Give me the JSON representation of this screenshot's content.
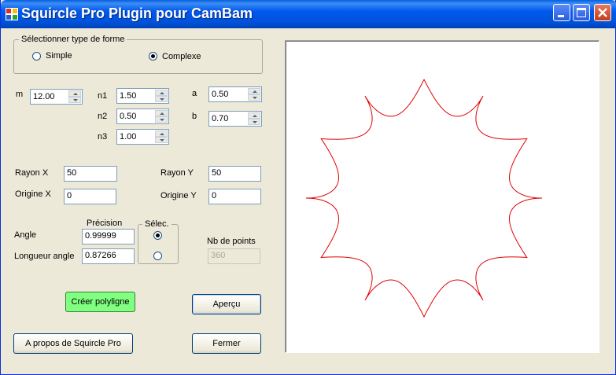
{
  "window": {
    "title": "Squircle Pro Plugin pour CamBam",
    "controls": [
      "minimize-icon",
      "maximize-icon",
      "close-icon"
    ]
  },
  "shape_type": {
    "legend": "Sélectionner type de forme",
    "simple_label": "Simple",
    "complex_label": "Complexe",
    "selected": "Complexe"
  },
  "params": {
    "m_label": "m",
    "m_value": "12.00",
    "n1_label": "n1",
    "n1_value": "1.50",
    "n2_label": "n2",
    "n2_value": "0.50",
    "n3_label": "n3",
    "n3_value": "1.00",
    "a_label": "a",
    "a_value": "0.50",
    "b_label": "b",
    "b_value": "0.70"
  },
  "geometry": {
    "rx_label": "Rayon X",
    "rx_value": "50",
    "ry_label": "Rayon Y",
    "ry_value": "50",
    "ox_label": "Origine X",
    "ox_value": "0",
    "oy_label": "Origine Y",
    "oy_value": "0"
  },
  "precision": {
    "header_label": "Précision",
    "select_legend": "Sélec.",
    "angle_label": "Angle",
    "angle_value": "0.99999",
    "length_label": "Longueur angle",
    "length_value": "0.87266",
    "selected": "Angle",
    "points_label": "Nb de points",
    "points_value": "360"
  },
  "buttons": {
    "create": "Créer polyligne",
    "preview": "Aperçu",
    "about": "A propos de Squircle Pro",
    "close": "Fermer"
  },
  "preview_color": "#e00000"
}
